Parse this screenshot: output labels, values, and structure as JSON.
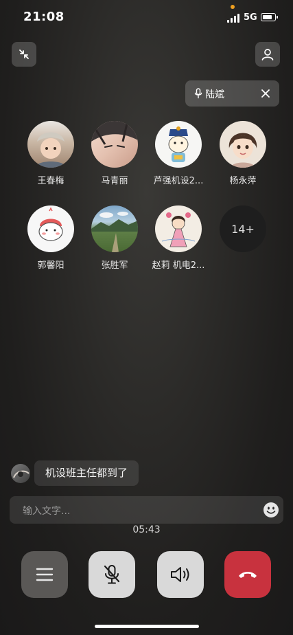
{
  "status_bar": {
    "time": "21:08",
    "network": "5G"
  },
  "speaking": {
    "name": "陆斌"
  },
  "members": [
    {
      "name": "王春梅",
      "avatar": "baby-photo"
    },
    {
      "name": "马青丽",
      "avatar": "girl-photo"
    },
    {
      "name": "芦强机设2...",
      "avatar": "cartoon-figure"
    },
    {
      "name": "杨永萍",
      "avatar": "cartoon-woman"
    },
    {
      "name": "郭馨阳",
      "avatar": "cartoon-bear"
    },
    {
      "name": "张胜军",
      "avatar": "landscape-photo"
    },
    {
      "name": "赵莉 机电2...",
      "avatar": "drawing-photo"
    }
  ],
  "more_count": "14+",
  "chat": {
    "message": "机设班主任都到了"
  },
  "input": {
    "placeholder": "输入文字..."
  },
  "call_duration": "05:43",
  "colors": {
    "hangup": "#c8323e",
    "control_light": "#d9d9d9",
    "control_dark": "#5a5856"
  }
}
